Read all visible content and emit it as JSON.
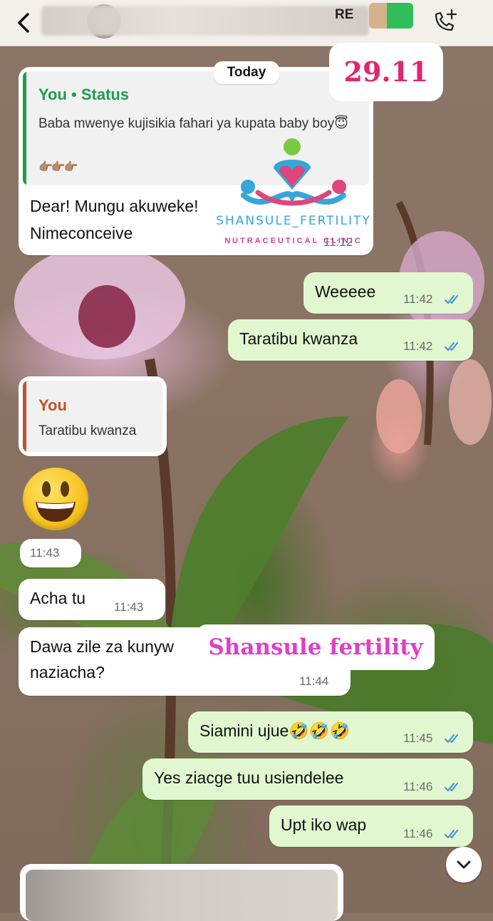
{
  "header": {
    "contact_name_fragment": "RE",
    "back_icon": "chevron-left-icon",
    "call_icon": "phone-add-icon"
  },
  "date_chip": "Today",
  "overlay": {
    "date_stamp": "29.11",
    "watermark_label": "Shansule fertility",
    "logo_name": "SHANSULE_FERTILITY",
    "logo_sub": "NUTRACEUTICAL CLINIC"
  },
  "messages": [
    {
      "direction": "in",
      "quote_author": "You • Status",
      "quote_text": "Baba mwenye kujisikia fahari ya kupata baby boy😇",
      "quote_extra": "👉🏽👉🏽👉🏽",
      "text_line1": "Dear! Mungu akuweke!",
      "text_line2": "Nimeconceive",
      "time": "11:12"
    },
    {
      "direction": "out",
      "text": "Weeeee",
      "time": "11:42"
    },
    {
      "direction": "out",
      "text": "Taratibu kwanza",
      "time": "11:42"
    },
    {
      "direction": "in",
      "quote_author": "You",
      "quote_text": "Taratibu kwanza"
    },
    {
      "direction": "in",
      "emoji": "😃",
      "time": "11:43"
    },
    {
      "direction": "in",
      "text": "Acha tu",
      "time": "11:43"
    },
    {
      "direction": "in",
      "text_line1": "Dawa zile za kunyw",
      "text_line2": "naziacha?",
      "time": "11:44"
    },
    {
      "direction": "out",
      "text": "Siamini ujue🤣🤣🤣",
      "time": "11:45"
    },
    {
      "direction": "out",
      "text": "Yes ziacge tuu usiendelee",
      "time": "11:46"
    },
    {
      "direction": "out",
      "text": "Upt iko wap",
      "time": "11:46"
    }
  ],
  "colors": {
    "incoming_bubble": "#ffffff",
    "outgoing_bubble": "#e0f7cf",
    "status_quote_accent": "#1f9d4c",
    "reply_quote_accent": "#c0522a",
    "read_ticks": "#3b8fd6",
    "date_stamp": "#e3246e",
    "watermark": "#e03fc7"
  },
  "icons": {
    "scroll_down": "chevron-down-icon",
    "read_receipt": "double-check-icon"
  }
}
